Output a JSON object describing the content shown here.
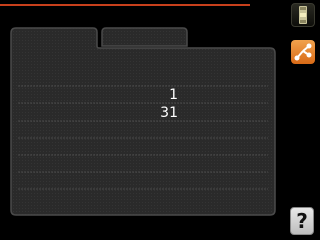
{
  "accent_color": "#c8401c",
  "panel": {
    "values": [
      "1",
      "31"
    ]
  },
  "side_buttons": {
    "slider_icon": "slider-icon",
    "network_icon": "network-icon",
    "help_label": "?"
  }
}
